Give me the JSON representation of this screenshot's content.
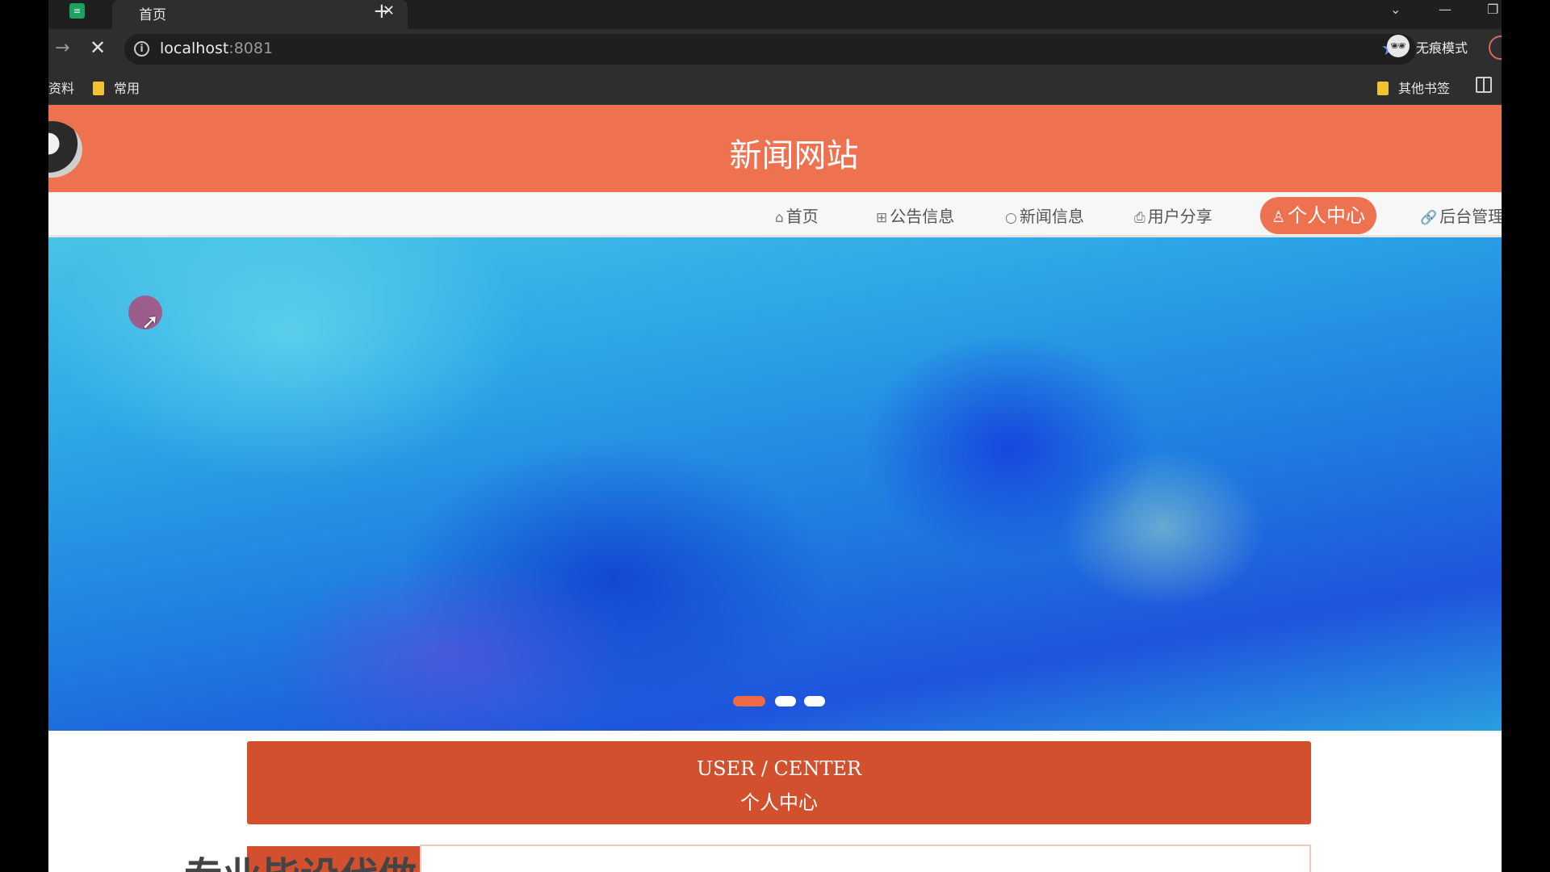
{
  "browser": {
    "tab_title": "首页",
    "tab_close": "✕",
    "new_tab": "+",
    "url_host": "localhost",
    "url_port": ":8081",
    "incognito_label": "无痕模式",
    "bookmarks": [
      {
        "label": "资料"
      },
      {
        "label": "常用"
      }
    ],
    "other_bookmarks": "其他书签"
  },
  "site": {
    "title": "新闻网站",
    "nav": [
      {
        "label": "首页",
        "icon": "home-icon",
        "glyph": "⌂"
      },
      {
        "label": "公告信息",
        "icon": "gift-icon",
        "glyph": "⊞"
      },
      {
        "label": "新闻信息",
        "icon": "circle-icon",
        "glyph": "○"
      },
      {
        "label": "用户分享",
        "icon": "printer-icon",
        "glyph": "⎙"
      },
      {
        "label": "个人中心",
        "icon": "user-icon",
        "glyph": "♙",
        "active": true
      },
      {
        "label": "后台管理",
        "icon": "link-icon",
        "glyph": "🔗"
      }
    ],
    "carousel": {
      "slides": 3,
      "active_index": 0
    },
    "section": {
      "title_en": "USER / CENTER",
      "title_cn": "个人中心"
    },
    "promo_text": "专业毕设代做"
  },
  "colors": {
    "accent": "#ee7150",
    "section_red": "#d3502f",
    "chrome_dark": "#1f1f1f",
    "chrome": "#2e2e2e"
  }
}
